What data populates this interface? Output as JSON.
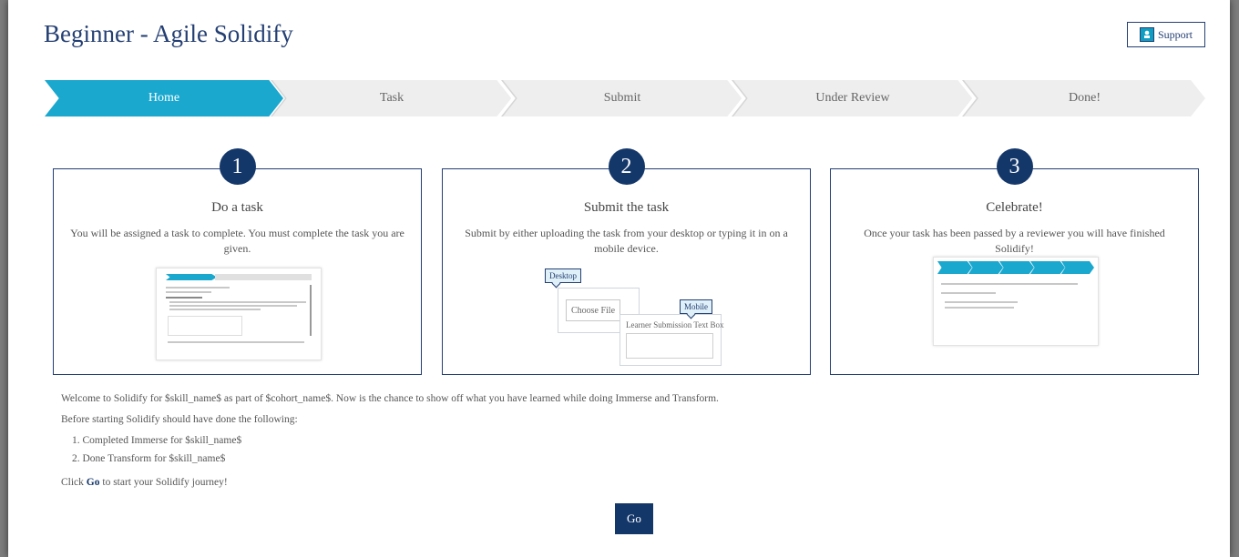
{
  "page": {
    "title": "Beginner - Agile Solidify"
  },
  "header": {
    "support_label": "Support",
    "support_icon": "support-icon"
  },
  "steps": [
    {
      "label": "Home",
      "state": "active"
    },
    {
      "label": "Task",
      "state": "inactive"
    },
    {
      "label": "Submit",
      "state": "inactive"
    },
    {
      "label": "Under Review",
      "state": "inactive"
    },
    {
      "label": "Done!",
      "state": "inactive"
    }
  ],
  "cards": [
    {
      "number": "1",
      "title": "Do a task",
      "text": "You will be assigned a task to complete. You must complete the task you are given."
    },
    {
      "number": "2",
      "title": "Submit the task",
      "text": "Submit by either uploading the task from your desktop or typing it in on a mobile device."
    },
    {
      "number": "3",
      "title": "Celebrate!",
      "text": "Once your task has been passed by a reviewer you will have finished Solidify!"
    }
  ],
  "illustration": {
    "desktop_label": "Desktop",
    "choose_file": "Choose File",
    "mobile_label": "Mobile",
    "text_box_label": "Learner Submission Text Box"
  },
  "intro": {
    "welcome": "Welcome to Solidify for $skill_name$ as part of $cohort_name$. Now is the chance to show off what you have learned while doing Immerse and Transform.",
    "before": "Before starting Solidify should have done the following:",
    "items": [
      "1. Completed Immerse for $skill_name$",
      "2. Done Transform for $skill_name$"
    ],
    "click_prefix": "Click ",
    "click_bold": "Go",
    "click_suffix": " to start your Solidify journey!"
  },
  "go_label": "Go",
  "colors": {
    "accent": "#1aa8cf",
    "navy": "#14376a",
    "title": "#243f73"
  }
}
